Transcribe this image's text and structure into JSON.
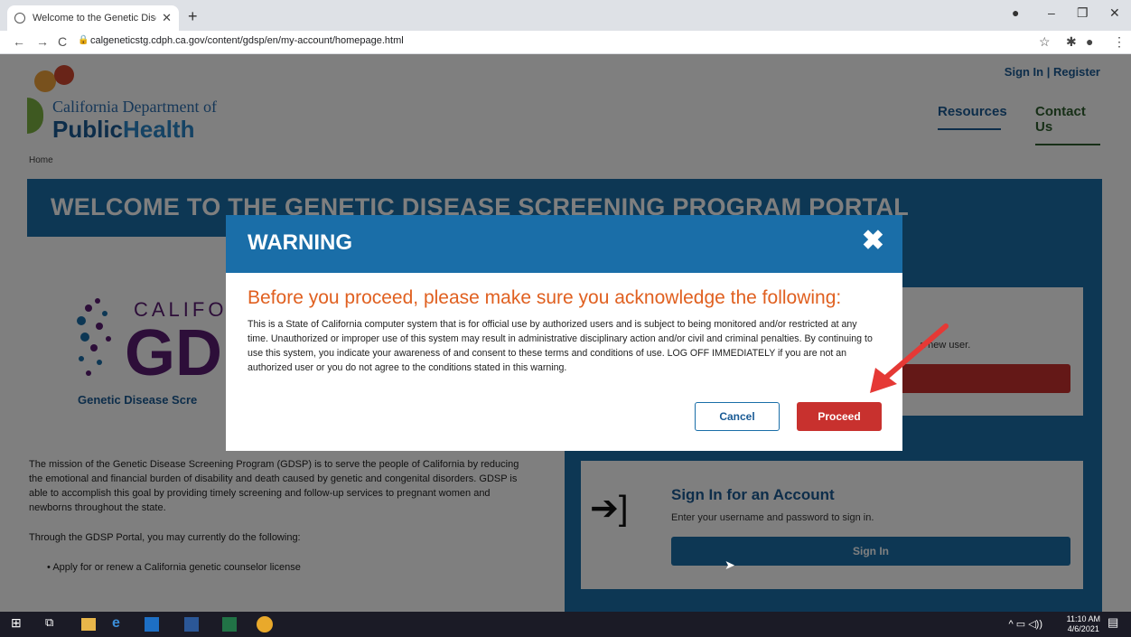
{
  "browser": {
    "tab_title": "Welcome to the Genetic Disease",
    "new_tab": "+",
    "url": "calgeneticstg.cdph.ca.gov/content/gdsp/en/my-account/homepage.html"
  },
  "header": {
    "org_line1": "California Department of",
    "org_line2a": "Public",
    "org_line2b": "Health",
    "sign_in": "Sign In | Register",
    "nav": [
      "Resources",
      "Contact Us"
    ]
  },
  "breadcrumb": "Home",
  "banner_title": "WELCOME TO THE GENETIC DISEASE SCREENING PROGRAM PORTAL",
  "gdsp_logo": {
    "top": "CALIFO",
    "big": "GD",
    "tagline": "Genetic Disease Scre"
  },
  "register_card": {
    "text": "a new user."
  },
  "signin_card": {
    "title": "Sign In for an Account",
    "subtitle": "Enter your username and password to sign in.",
    "button": "Sign In"
  },
  "mission": "The mission of the Genetic Disease Screening Program (GDSP) is to serve the people of California by reducing the emotional and financial burden of disability and death caused by genetic and congenital disorders. GDSP is able to accomplish this goal by providing timely screening and follow-up services to pregnant women and newborns throughout the state.",
  "through": "Through the GDSP Portal, you may currently do the following:",
  "bullets": [
    "Apply for or renew a California genetic counselor license"
  ],
  "modal": {
    "title": "WARNING",
    "close": "✖",
    "subtitle": "Before you proceed, please make sure you acknowledge the following:",
    "body": "This is a State of California computer system that is for official use by authorized users and is subject to being monitored and/or restricted at any time. Unauthorized or improper use of this system may result in administrative disciplinary action and/or civil and criminal penalties. By continuing to use this system, you indicate your awareness of and consent to these terms and conditions of use. LOG OFF IMMEDIATELY if you are not an authorized user or you do not agree to the conditions stated in this warning.",
    "cancel": "Cancel",
    "proceed": "Proceed"
  },
  "taskbar": {
    "time": "11:10 AM",
    "date": "4/6/2021"
  },
  "colors": {
    "primary": "#1a6ea8",
    "danger": "#c8312e",
    "accent": "#e06020"
  }
}
